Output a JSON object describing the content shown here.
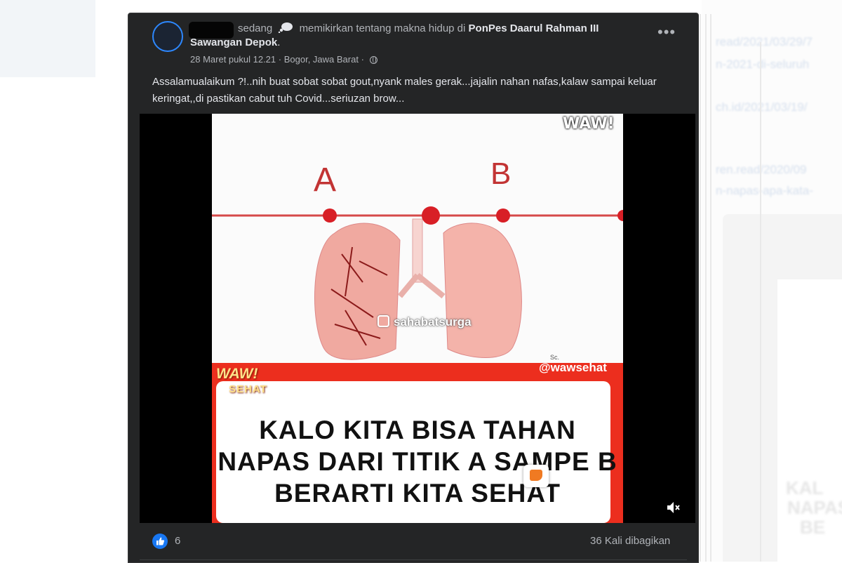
{
  "post": {
    "status_verb": "sedang",
    "status_text": "memikirkan tentang makna hidup di",
    "place_line1": "PonPes Daarul Rahman III",
    "place_line2": "Sawangan Depok",
    "date": "28 Maret pukul 12.21",
    "location": "Bogor, Jawa Barat",
    "caption": "Assalamualaikum ?!..nih buat sobat sobat gout,nyank males gerak...jajalin nahan nafas,kalaw sampai keluar keringat,,di pastikan cabut tuh Covid...seriuzan brow...",
    "likes": "6",
    "shares": "36 Kali dibagikan"
  },
  "video": {
    "label_a": "A",
    "label_b": "B",
    "watermark": "sahabatsurga",
    "brand_top": "WAW!",
    "brand_logo_line1": "WAW!",
    "brand_logo_line2": "SEHAT",
    "handle": "@wawsehat",
    "headline": [
      "KALO KITA BISA TAHAN",
      "NAPAS DARI TITIK A SAMPE B",
      "BERARTI KITA SEHAT"
    ]
  },
  "colors": {
    "post_bg": "#242526",
    "banner_red": "#ec2e1e",
    "like_blue": "#1877f2"
  },
  "icons": [
    "thought-bubble-icon",
    "globe-icon",
    "more-options-icon",
    "mute-icon",
    "like-icon",
    "instagram-icon"
  ]
}
